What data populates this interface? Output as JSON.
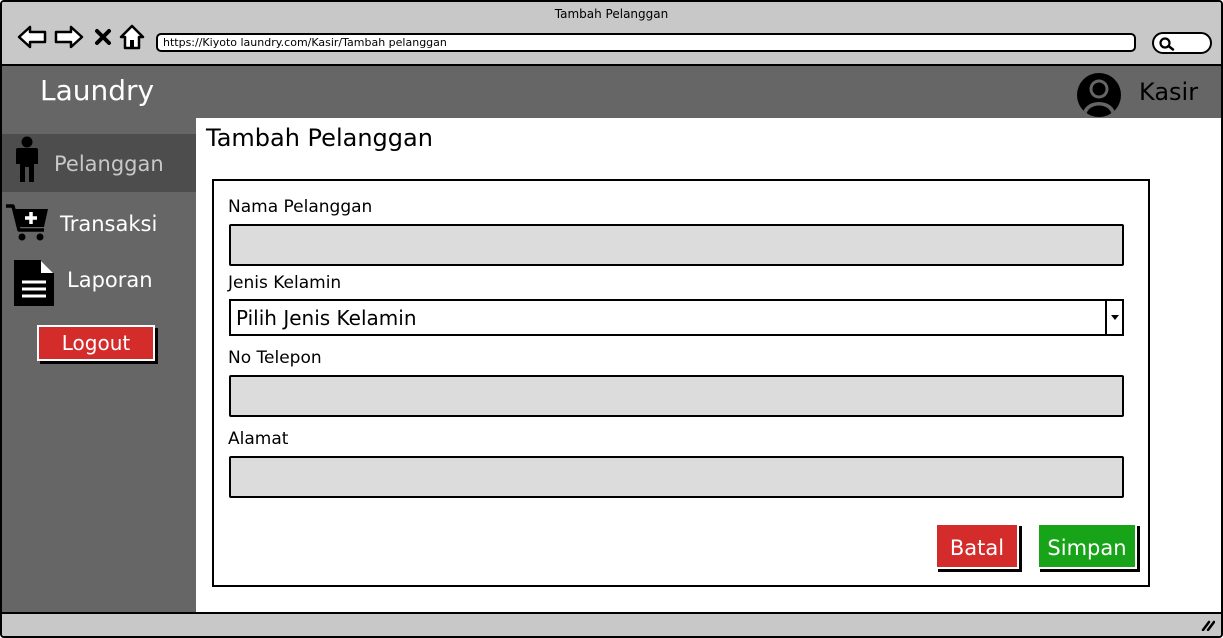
{
  "window": {
    "title": "Tambah Pelanggan"
  },
  "browser": {
    "url": "https://Kiyoto laundry.com/Kasir/Tambah pelanggan",
    "icons": [
      "back-arrow-icon",
      "forward-arrow-icon",
      "close-x-icon",
      "home-icon",
      "search-icon"
    ]
  },
  "header": {
    "brand": "Laundry",
    "user": "Kasir",
    "user_icon": "user-avatar-icon"
  },
  "sidebar": {
    "items": [
      {
        "label": "Pelanggan",
        "icon": "person-icon",
        "active": true
      },
      {
        "label": "Transaksi",
        "icon": "cart-add-icon",
        "active": false
      },
      {
        "label": "Laporan",
        "icon": "document-icon",
        "active": false
      }
    ],
    "logout_label": "Logout"
  },
  "main": {
    "title": "Tambah Pelanggan",
    "form": {
      "name_label": "Nama Pelanggan",
      "name_value": "",
      "gender_label": "Jenis Kelamin",
      "gender_selected": "Pilih Jenis Kelamin",
      "phone_label": "No Telepon",
      "phone_value": "",
      "address_label": "Alamat",
      "address_value": "",
      "cancel_label": "Batal",
      "save_label": "Simpan"
    }
  },
  "colors": {
    "chrome": "#c8c8c8",
    "header": "#666666",
    "sidebar_active": "#4d4d4d",
    "danger": "#d42b2b",
    "success": "#18a418",
    "input_bg": "#dcdcdc"
  }
}
